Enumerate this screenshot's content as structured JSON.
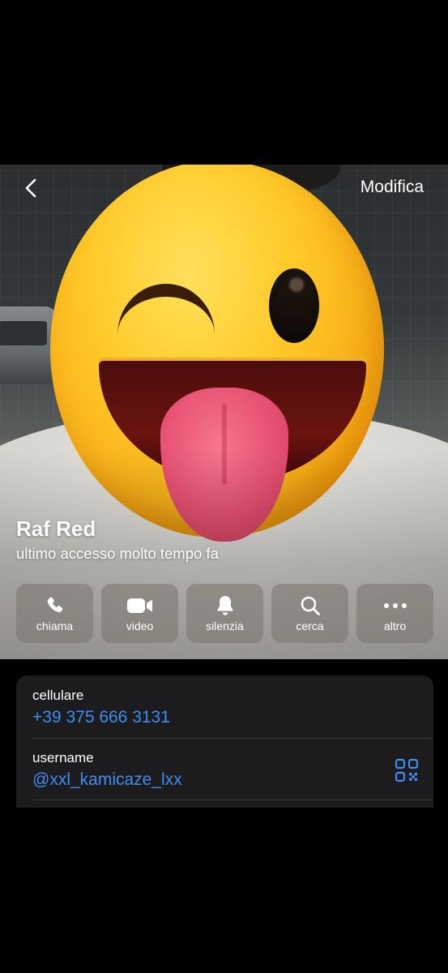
{
  "navigation": {
    "back_icon": "chevron-left-icon",
    "edit_label": "Modifica"
  },
  "profile": {
    "name": "Raf Red",
    "status": "ultimo accesso molto tempo fa",
    "photo": "profile-photo-covered-by-winking-tongue-emoji"
  },
  "actions": [
    {
      "label": "chiama",
      "icon": "phone-icon"
    },
    {
      "label": "video",
      "icon": "video-camera-icon"
    },
    {
      "label": "silenzia",
      "icon": "bell-icon"
    },
    {
      "label": "cerca",
      "icon": "search-icon"
    },
    {
      "label": "altro",
      "icon": "more-icon"
    }
  ],
  "info": {
    "phone_label": "cellulare",
    "phone_value": "+39 375 666 3131",
    "username_label": "username",
    "username_value": "@xxl_kamicaze_lxx",
    "qr_icon": "qr-code-icon"
  },
  "colors": {
    "link_blue": "#3e8ef0",
    "card_background": "#1c1c1e",
    "screen_background": "#000000"
  }
}
